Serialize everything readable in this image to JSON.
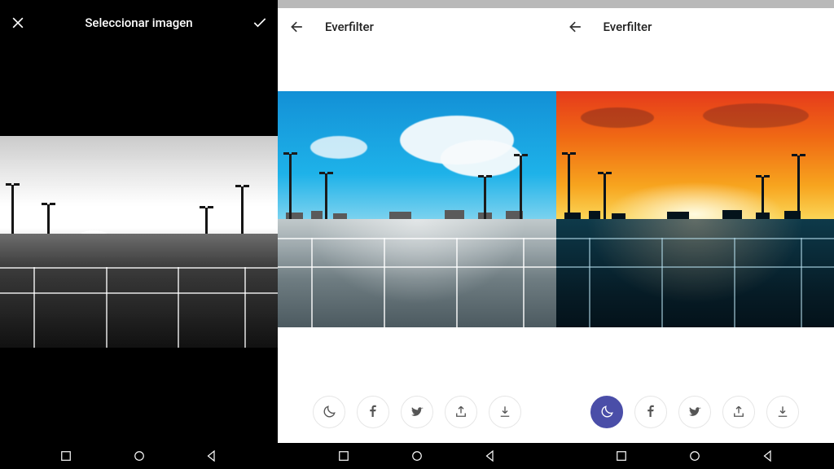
{
  "panel1": {
    "title": "Seleccionar imagen",
    "close_icon": "close-icon",
    "confirm_icon": "check-icon",
    "image_description": "Black and white parking lot at sunset",
    "nav": {
      "recent": "recent-apps",
      "home": "home",
      "back": "back"
    }
  },
  "panel2": {
    "app_title": "Everfilter",
    "back_icon": "arrow-left-icon",
    "filter_applied": "blue-sky-day",
    "image_description": "Parking lot with bright blue sky and clouds filter",
    "actions": {
      "moon": {
        "icon": "moon-icon",
        "active": false
      },
      "facebook": {
        "icon": "facebook-icon"
      },
      "twitter": {
        "icon": "twitter-icon"
      },
      "share": {
        "icon": "share-icon"
      },
      "download": {
        "icon": "download-icon"
      }
    },
    "nav": {
      "recent": "recent-apps",
      "home": "home",
      "back": "back"
    }
  },
  "panel3": {
    "app_title": "Everfilter",
    "back_icon": "arrow-left-icon",
    "filter_applied": "sunset-night",
    "image_description": "Parking lot with orange sunset sky filter",
    "actions": {
      "moon": {
        "icon": "moon-icon",
        "active": true
      },
      "facebook": {
        "icon": "facebook-icon"
      },
      "twitter": {
        "icon": "twitter-icon"
      },
      "share": {
        "icon": "share-icon"
      },
      "download": {
        "icon": "download-icon"
      }
    },
    "nav": {
      "recent": "recent-apps",
      "home": "home",
      "back": "back"
    }
  },
  "colors": {
    "everfilter_primary": "#4a4ea8",
    "panel1_bg": "#000000",
    "panel_light_bg": "#ffffff"
  }
}
